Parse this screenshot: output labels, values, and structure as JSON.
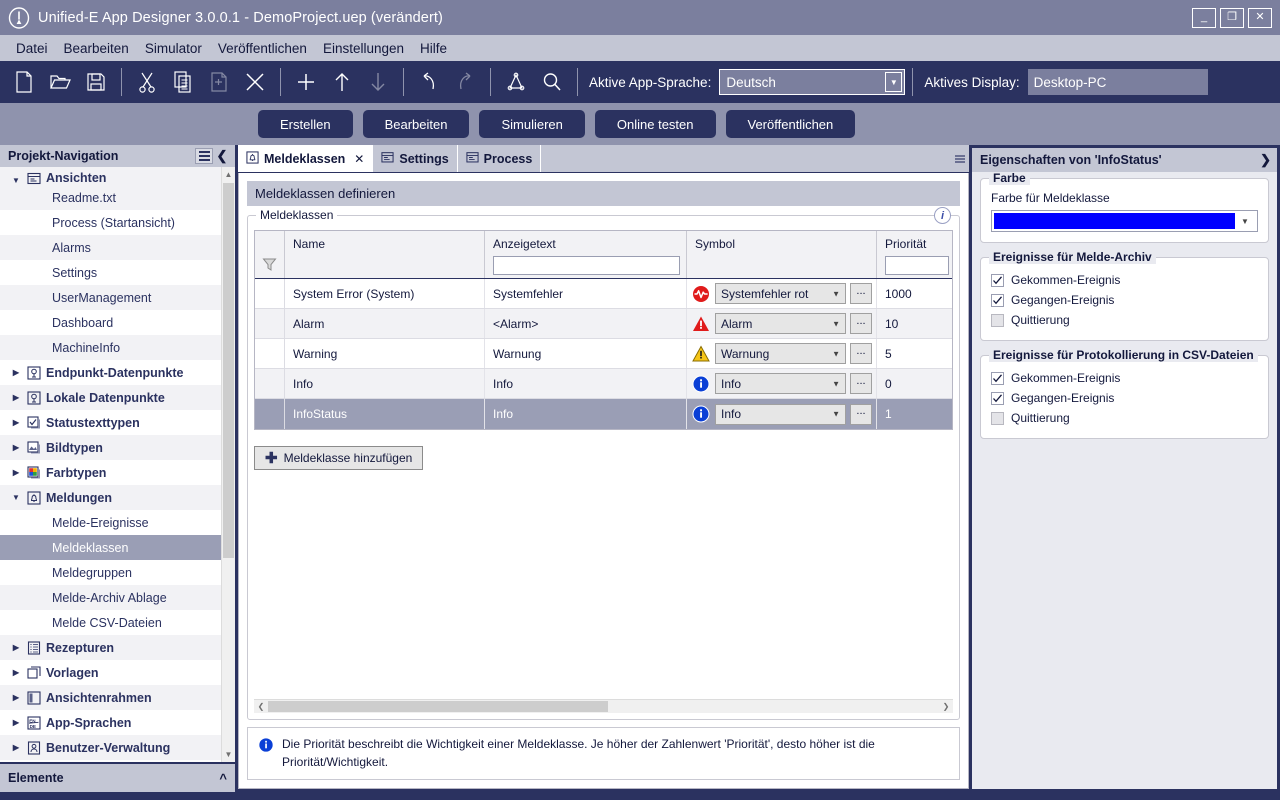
{
  "window": {
    "title": "Unified-E App Designer 3.0.0.1 - DemoProject.uep  (verändert)",
    "logo_icon": "unified-e-logo-icon",
    "minimize_label": "_",
    "maximize_label": "❐",
    "close_label": "✕"
  },
  "menu": {
    "items": [
      {
        "label": "Datei"
      },
      {
        "label": "Bearbeiten"
      },
      {
        "label": "Simulator"
      },
      {
        "label": "Veröffentlichen"
      },
      {
        "label": "Einstellungen"
      },
      {
        "label": "Hilfe"
      }
    ]
  },
  "toolbar": {
    "buttons": [
      {
        "name": "new-file-icon",
        "enabled": true
      },
      {
        "name": "open-folder-icon",
        "enabled": true
      },
      {
        "name": "save-icon",
        "enabled": true
      },
      {
        "sep": true
      },
      {
        "name": "cut-scissors-icon",
        "enabled": true
      },
      {
        "name": "copy-icon",
        "enabled": true
      },
      {
        "name": "paste-icon",
        "enabled": false
      },
      {
        "name": "delete-x-icon",
        "enabled": true
      },
      {
        "sep": true
      },
      {
        "name": "add-plus-icon",
        "enabled": true
      },
      {
        "name": "move-up-arrow-icon",
        "enabled": true
      },
      {
        "name": "move-down-arrow-icon",
        "enabled": false
      },
      {
        "sep": true
      },
      {
        "name": "undo-icon",
        "enabled": true
      },
      {
        "name": "redo-icon",
        "enabled": false
      },
      {
        "sep": true
      },
      {
        "name": "network-graph-icon",
        "enabled": true
      },
      {
        "name": "search-magnifier-icon",
        "enabled": true
      }
    ],
    "app_language_label": "Aktive App-Sprache:",
    "app_language_value": "Deutsch",
    "display_label": "Aktives Display:",
    "display_value": "Desktop-PC"
  },
  "actionbar": {
    "buttons": [
      {
        "label": "Erstellen"
      },
      {
        "label": "Bearbeiten"
      },
      {
        "label": "Simulieren"
      },
      {
        "label": "Online testen"
      },
      {
        "label": "Veröffentlichen"
      }
    ]
  },
  "sidebar": {
    "header_title": "Projekt-Navigation",
    "menu_icon": "hamburger-menu-icon",
    "collapse_icon": "chevron-left-icon",
    "footer_title": "Elemente",
    "footer_icon": "chevron-up-icon",
    "tree": [
      {
        "label": "Ansichten",
        "type": "group",
        "icon": "views-icon",
        "expanded": true,
        "selected": false
      },
      {
        "label": "Readme.txt",
        "type": "leaf",
        "icon": "",
        "selected": false
      },
      {
        "label": "Process (Startansicht)",
        "type": "leaf",
        "icon": "",
        "selected": false
      },
      {
        "label": "Alarms",
        "type": "leaf",
        "icon": "",
        "selected": false
      },
      {
        "label": "Settings",
        "type": "leaf",
        "icon": "",
        "selected": false
      },
      {
        "label": "UserManagement",
        "type": "leaf",
        "icon": "",
        "selected": false
      },
      {
        "label": "Dashboard",
        "type": "leaf",
        "icon": "",
        "selected": false
      },
      {
        "label": "MachineInfo",
        "type": "leaf",
        "icon": "",
        "selected": false
      },
      {
        "label": "Endpunkt-Datenpunkte",
        "type": "group",
        "icon": "endpoint-datapoint-icon",
        "expanded": false,
        "selected": false
      },
      {
        "label": "Lokale Datenpunkte",
        "type": "group",
        "icon": "local-datapoint-icon",
        "expanded": false,
        "selected": false
      },
      {
        "label": "Statustexttypen",
        "type": "group",
        "icon": "status-text-type-icon",
        "expanded": false,
        "selected": false
      },
      {
        "label": "Bildtypen",
        "type": "group",
        "icon": "image-type-icon",
        "expanded": false,
        "selected": false
      },
      {
        "label": "Farbtypen",
        "type": "group",
        "icon": "color-type-icon",
        "expanded": false,
        "selected": false
      },
      {
        "label": "Meldungen",
        "type": "group",
        "icon": "bell-messages-icon",
        "expanded": true,
        "selected": false
      },
      {
        "label": "Melde-Ereignisse",
        "type": "leaf",
        "icon": "",
        "selected": false
      },
      {
        "label": "Meldeklassen",
        "type": "leaf",
        "icon": "",
        "selected": true
      },
      {
        "label": "Meldegruppen",
        "type": "leaf",
        "icon": "",
        "selected": false
      },
      {
        "label": "Melde-Archiv Ablage",
        "type": "leaf",
        "icon": "",
        "selected": false
      },
      {
        "label": "Melde CSV-Dateien",
        "type": "leaf",
        "icon": "",
        "selected": false
      },
      {
        "label": "Rezepturen",
        "type": "group",
        "icon": "recipes-icon",
        "expanded": false,
        "selected": false
      },
      {
        "label": "Vorlagen",
        "type": "group",
        "icon": "templates-icon",
        "expanded": false,
        "selected": false
      },
      {
        "label": "Ansichtenrahmen",
        "type": "group",
        "icon": "view-frame-icon",
        "expanded": false,
        "selected": false
      },
      {
        "label": "App-Sprachen",
        "type": "group",
        "icon": "languages-icon",
        "expanded": false,
        "selected": false
      },
      {
        "label": "Benutzer-Verwaltung",
        "type": "group",
        "icon": "user-management-icon",
        "expanded": false,
        "selected": false
      }
    ]
  },
  "tabs": [
    {
      "label": "Meldeklassen",
      "icon": "bell-icon",
      "active": true,
      "closable": true,
      "close_label": "✕"
    },
    {
      "label": "Settings",
      "icon": "view-icon",
      "active": false,
      "closable": false
    },
    {
      "label": "Process",
      "icon": "view-icon",
      "active": false,
      "closable": false
    }
  ],
  "main": {
    "page_title": "Meldeklassen definieren",
    "group_legend": "Meldeklassen",
    "info_badge": "i",
    "filter_icon": "filter-funnel-icon",
    "columns": [
      {
        "key": "name",
        "label": "Name",
        "has_filter_input": false
      },
      {
        "key": "text",
        "label": "Anzeigetext",
        "has_filter_input": true,
        "filter_value": ""
      },
      {
        "key": "symbol",
        "label": "Symbol",
        "has_filter_input": false
      },
      {
        "key": "prio",
        "label": "Priorität",
        "has_filter_input": true,
        "filter_value": ""
      }
    ],
    "rows": [
      {
        "name": "System Error (System)",
        "text": "Systemfehler",
        "symbol_icon": "system-error-red-icon",
        "symbol": "Systemfehler rot",
        "prio": "1000",
        "selected": false
      },
      {
        "name": "Alarm",
        "text": "<Alarm>",
        "symbol_icon": "alarm-triangle-red-icon",
        "symbol": "Alarm",
        "prio": "10",
        "selected": false
      },
      {
        "name": "Warning",
        "text": "Warnung",
        "symbol_icon": "warning-triangle-yellow-icon",
        "symbol": "Warnung",
        "prio": "5",
        "selected": false
      },
      {
        "name": "Info",
        "text": "Info",
        "symbol_icon": "info-circle-blue-icon",
        "symbol": "Info",
        "prio": "0",
        "selected": false
      },
      {
        "name": "InfoStatus",
        "text": "Info",
        "symbol_icon": "info-circle-blue-icon",
        "symbol": "Info",
        "prio": "1",
        "selected": true
      }
    ],
    "browse_button_label": "...",
    "add_button_label": "Meldeklasse hinzufügen",
    "add_button_icon": "plus-icon",
    "hint_icon": "info-circle-blue-icon",
    "hint_text": "Die Priorität beschreibt die Wichtigkeit einer Meldeklasse. Je höher der Zahlenwert 'Priorität', desto höher ist die Priorität/Wichtigkeit."
  },
  "properties": {
    "header": "Eigenschaften von 'InfoStatus'",
    "collapse_icon": "chevron-right-icon",
    "color_group_legend": "Farbe",
    "color_label": "Farbe für Meldeklasse",
    "color_value": "#0000FF",
    "archive_group_legend": "Ereignisse für Melde-Archiv",
    "archive_options": [
      {
        "label": "Gekommen-Ereignis",
        "checked": true
      },
      {
        "label": "Gegangen-Ereignis",
        "checked": true
      },
      {
        "label": "Quittierung",
        "checked": false
      }
    ],
    "csv_group_legend": "Ereignisse für Protokollierung in CSV-Dateien",
    "csv_options": [
      {
        "label": "Gekommen-Ereignis",
        "checked": true
      },
      {
        "label": "Gegangen-Ereignis",
        "checked": true
      },
      {
        "label": "Quittierung",
        "checked": false
      }
    ]
  },
  "theme": {
    "dark_navy": "#2b3260",
    "title_bar": "#7b7f9e",
    "menu_bar": "#c3c6d4",
    "selection": "#9a9eb5",
    "accent_blue": "#0000FF"
  }
}
